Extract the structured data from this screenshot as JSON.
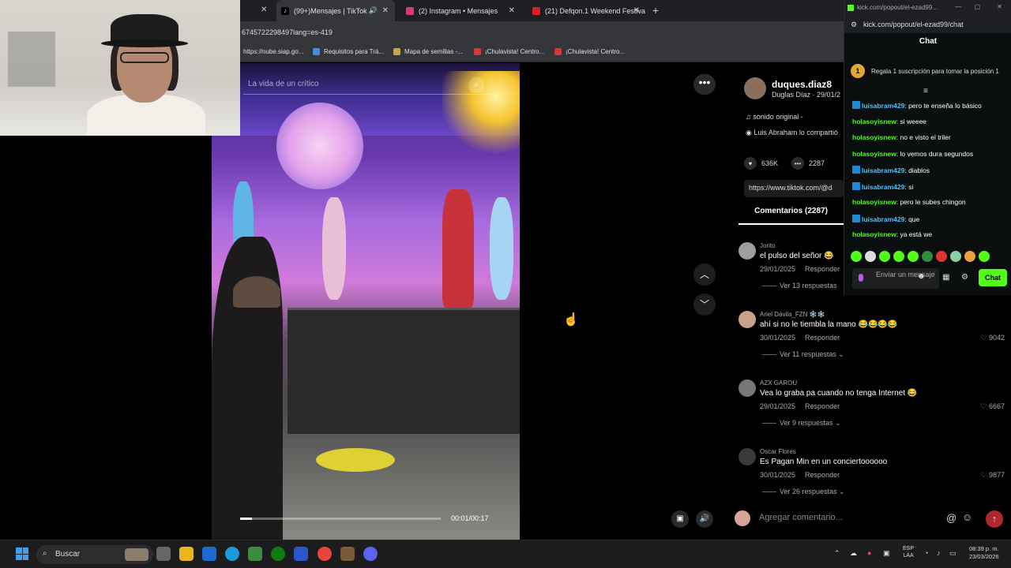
{
  "browser": {
    "tabs": [
      {
        "label": "(99+)Mensajes | TikTok"
      },
      {
        "label": "(2) Instagram • Mensajes"
      },
      {
        "label": "(21) Defqon.1 Weekend Festiva"
      }
    ],
    "url": "6745722298497lang=es-419",
    "bookmarks": [
      {
        "label": "https://nube.siap.go..."
      },
      {
        "label": "Requisitos para Trá..."
      },
      {
        "label": "Mapa de semillas -..."
      },
      {
        "label": "¡Chulavista! Centro..."
      },
      {
        "label": "¡Chulavista! Centro..."
      }
    ]
  },
  "video": {
    "search_placeholder": "La vida de un crítico",
    "time": "00:01/00:17",
    "progress": 0.06
  },
  "post": {
    "author": "duques.diaz8",
    "author_sub": "Duglas Díaz · 29/01/2",
    "sound": "sonido original -",
    "shared_by": "Luis Abraham lo compartió",
    "likes": "636K",
    "comments_count": "2287",
    "link": "https://www.tiktok.com/@d",
    "comments_tab": "Comentarios (2287)"
  },
  "comments": [
    {
      "user": "Jorito",
      "text": "el pulso del señor 😂",
      "date": "29/01/2025",
      "reply": "Responder",
      "likes": "",
      "replies": "Ver 13 respuestas",
      "avatar_color": "#9e9e9e"
    },
    {
      "user": "Ariel Dávila_FZN ❄️❄️",
      "text": "ahí si no le tiembla la mano 😂😂😂😂",
      "date": "30/01/2025",
      "reply": "Responder",
      "likes": "9042",
      "replies": "Ver 11 respuestas ⌄",
      "avatar_color": "#c9a08b"
    },
    {
      "user": "AZX GAROU",
      "text": "Vea lo graba pa cuando no tenga Internet 😂",
      "date": "29/01/2025",
      "reply": "Responder",
      "likes": "6667",
      "replies": "Ver 9 respuestas ⌄",
      "avatar_color": "#777"
    },
    {
      "user": "Oscar Flores",
      "text": "Es Pagan Min en un conciertoooooo",
      "date": "30/01/2025",
      "reply": "Responder",
      "likes": "9877",
      "replies": "Ver 26 respuestas ⌄",
      "avatar_color": "#3a3a3a"
    }
  ],
  "comment_input": {
    "placeholder": "Agregar comentario..."
  },
  "kick": {
    "window_title": "kick.com/popout/el-ezad99...",
    "url": "kick.com/popout/el-ezad99/chat",
    "title": "Chat",
    "pinned": "Regala 1 suscripción para tomar la posición 1",
    "pinned_badge": "1",
    "messages": [
      {
        "user": "luisabram429",
        "text": ": pero te enseña lo básico",
        "color": "#4fc3f7",
        "sub": true
      },
      {
        "user": "holasoyisnew",
        "text": ": si weeee",
        "color": "#53fc18",
        "sub": false
      },
      {
        "user": "holasoyisnew",
        "text": ": no e visto el triler",
        "color": "#53fc18",
        "sub": false
      },
      {
        "user": "holasoyisnew",
        "text": ": lo vemos dura segundos",
        "color": "#53fc18",
        "sub": false
      },
      {
        "user": "luisabram429",
        "text": ": diablos",
        "color": "#4fc3f7",
        "sub": true
      },
      {
        "user": "luisabram429",
        "text": ": si",
        "color": "#4fc3f7",
        "sub": true
      },
      {
        "user": "holasoyisnew",
        "text": ": pero le subes chingon",
        "color": "#53fc18",
        "sub": false
      },
      {
        "user": "luisabram429",
        "text": ": que",
        "color": "#4fc3f7",
        "sub": true
      },
      {
        "user": "holasoyisnew",
        "text": ": ya está we",
        "color": "#53fc18",
        "sub": false
      }
    ],
    "input_placeholder": "Enviar un mensaje",
    "send_label": "Chat"
  },
  "taskbar": {
    "search": "Buscar",
    "lang_top": "ESP",
    "lang_bottom": "LAA",
    "time": "08:39 p. m.",
    "date": "23/03/2026"
  }
}
